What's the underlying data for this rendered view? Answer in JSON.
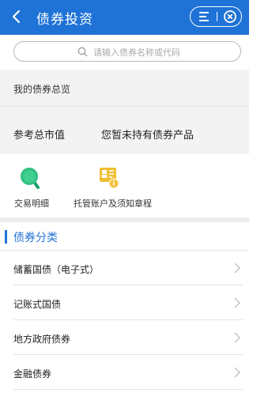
{
  "header": {
    "title": "债券投资"
  },
  "search": {
    "placeholder": "请输入债券名称或代码"
  },
  "overview": {
    "title": "我的债券总览",
    "label": "参考总市值",
    "value": "您暂未持有债券产品"
  },
  "functions": [
    {
      "label": "交易明细",
      "icon": "search-icon"
    },
    {
      "label": "托管账户及须知章程",
      "icon": "account-document-icon"
    }
  ],
  "category": {
    "title": "债券分类",
    "items": [
      {
        "label": "储蓄国债（电子式）"
      },
      {
        "label": "记账式国债"
      },
      {
        "label": "地方政府债券"
      },
      {
        "label": "金融债券"
      }
    ]
  },
  "colors": {
    "brand": "#1f72d6",
    "green": "#26b37a",
    "gold": "#e8b22a"
  }
}
